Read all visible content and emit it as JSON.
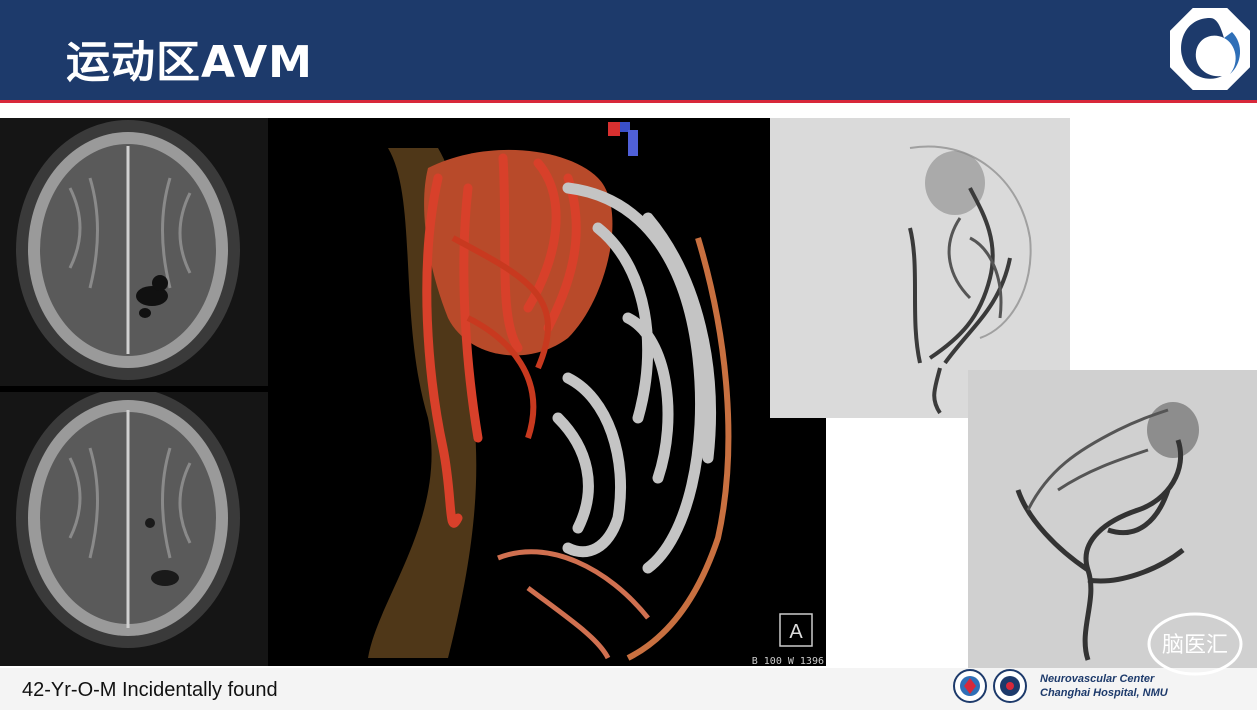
{
  "slide": {
    "title": "运动区AVM"
  },
  "recon": {
    "orientation_label": "A",
    "window_text": "B  100   W  1396"
  },
  "caption": "42-Yr-O-M Incidentally found",
  "footer": {
    "line1": "Neurovascular Center",
    "line2": "Changhai  Hospital, NMU"
  },
  "watermark": {
    "text": "脑医汇"
  },
  "colors": {
    "header": "#1d3a6b",
    "accent": "#d8283a",
    "artery": "#c8391f",
    "vein": "#b9b9b9"
  }
}
